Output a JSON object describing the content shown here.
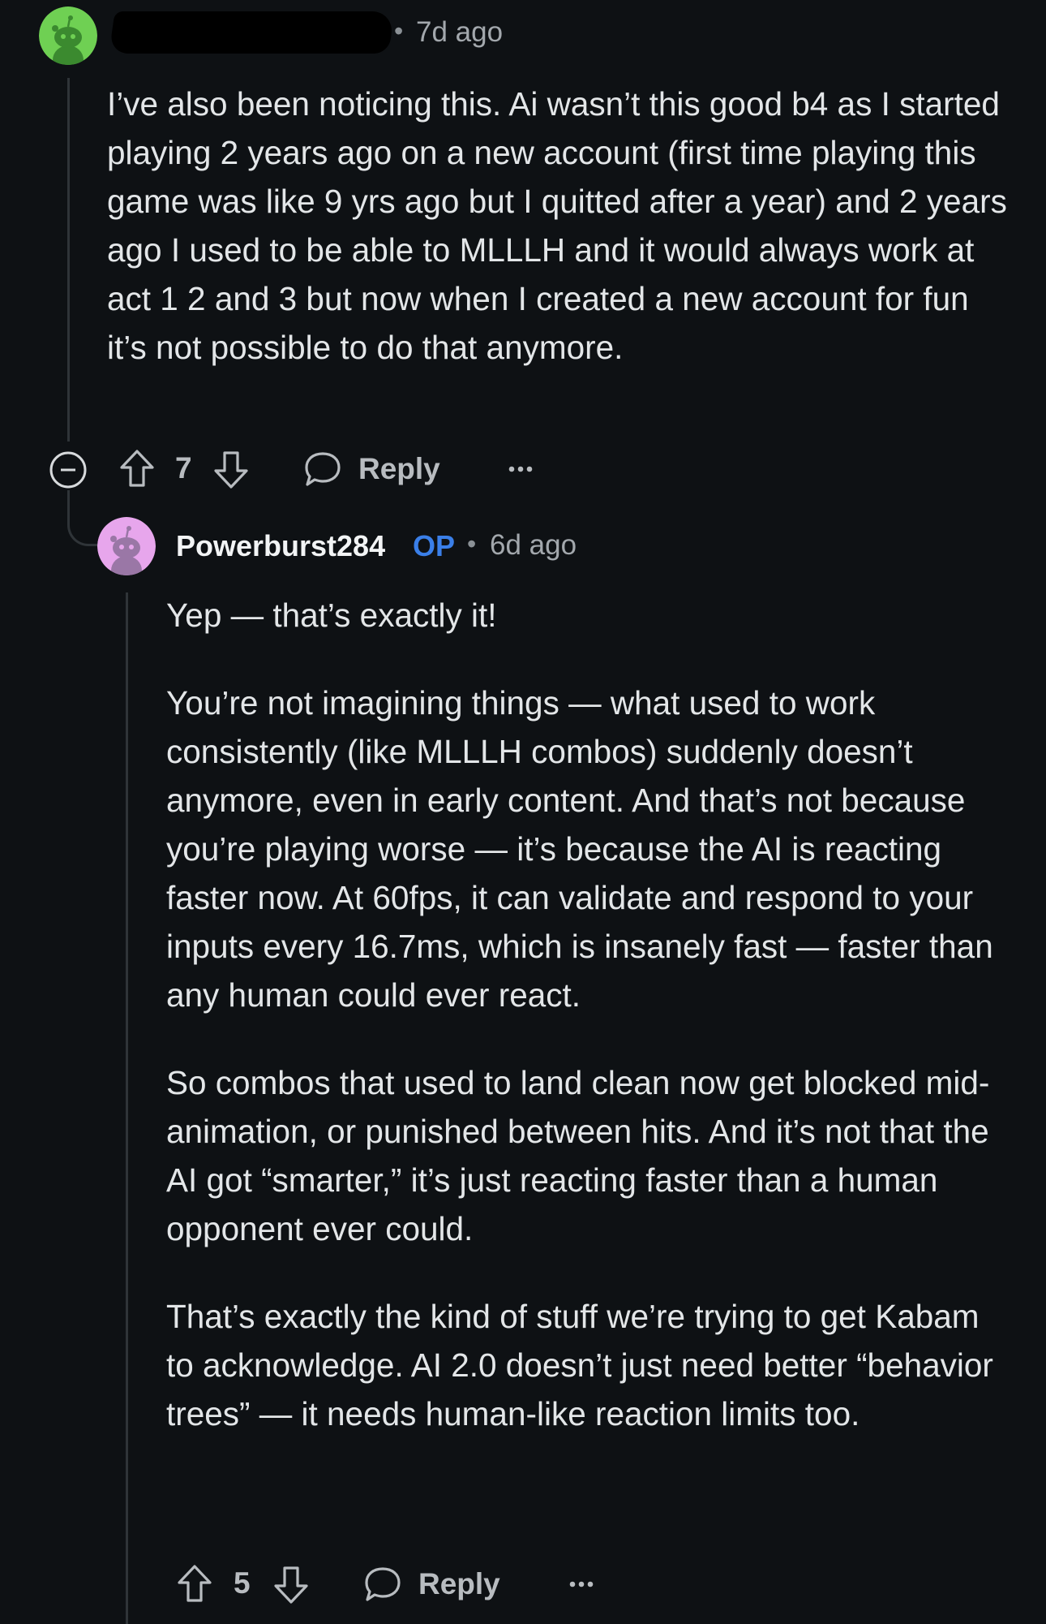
{
  "comment1": {
    "username": "",
    "time": "7d ago",
    "body": [
      "I’ve also been noticing this. Ai wasn’t this good b4 as I started playing 2 years ago on a new account (first time playing this game was like 9 yrs ago but I quitted after a year) and 2 years ago I used to be able to MLLLH and it would always work at act 1 2 and 3 but now when I created a new account for fun it’s not possible to do that anymore."
    ],
    "votes": "7",
    "reply_label": "Reply",
    "avatar_color": "#6fd053"
  },
  "comment2": {
    "username": "Powerburst284",
    "op_badge": "OP",
    "time": "6d ago",
    "body": [
      "Yep — that’s exactly it!",
      "You’re not imagining things — what used to work consistently (like MLLLH combos) suddenly doesn’t anymore, even in early content. And that’s not because you’re playing worse — it’s because the AI is reacting faster now. At 60fps, it can validate and respond to your inputs every 16.7ms, which is insanely fast — faster than any human could ever react.",
      "So combos that used to land clean now get blocked mid-animation, or punished between hits. And it’s not that the AI got “smarter,” it’s just reacting faster than a human opponent ever could.",
      "That’s exactly the kind of stuff we’re trying to get Kabam to acknowledge. AI 2.0 doesn’t just need better “behavior trees” — it needs human-like reaction limits too."
    ],
    "votes": "5",
    "reply_label": "Reply",
    "avatar_color": "#e7a6ec",
    "op_color": "#3a7fe8"
  },
  "colors": {
    "background": "#0e1114",
    "thread_line": "#2f3438"
  }
}
